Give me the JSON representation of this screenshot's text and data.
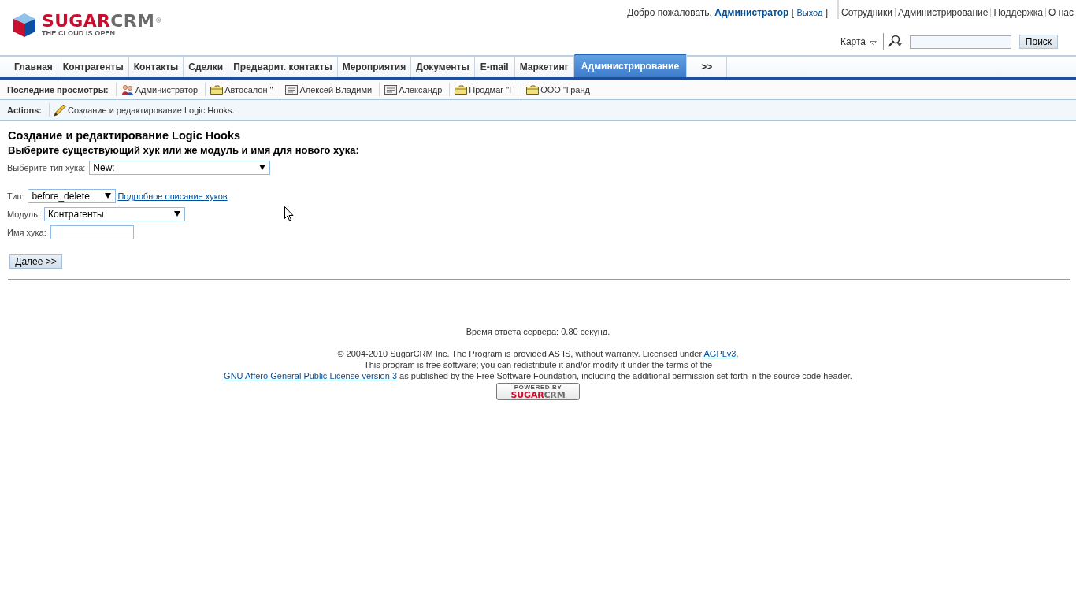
{
  "header": {
    "logo": {
      "brand_primary": "SUGAR",
      "brand_secondary": "CRM",
      "registered_mark": "®",
      "tagline": "THE CLOUD IS OPEN"
    },
    "welcome": {
      "greeting": "Добро пожаловать,",
      "user": "Администратор",
      "logout_open": "[",
      "logout": "Выход",
      "logout_close": "]"
    },
    "top_links": [
      "Сотрудники",
      "Администрирование",
      "Поддержка",
      "О нас"
    ],
    "sitemap": "Карта",
    "search": {
      "button": "Поиск"
    }
  },
  "tabs": [
    {
      "label": "Главная",
      "selected": false
    },
    {
      "label": "Контрагенты",
      "selected": false
    },
    {
      "label": "Контакты",
      "selected": false
    },
    {
      "label": "Сделки",
      "selected": false
    },
    {
      "label": "Предварит. контакты",
      "selected": false
    },
    {
      "label": "Мероприятия",
      "selected": false
    },
    {
      "label": "Документы",
      "selected": false
    },
    {
      "label": "E-mail",
      "selected": false
    },
    {
      "label": "Маркетинг",
      "selected": false
    },
    {
      "label": "Администрирование",
      "selected": true
    },
    {
      "label": ">>",
      "selected": false
    }
  ],
  "recent": {
    "label": "Последние просмотры:",
    "items": [
      {
        "kind": "user",
        "label": "Администратор"
      },
      {
        "kind": "account",
        "label": "Автосалон \""
      },
      {
        "kind": "contact",
        "label": "Алексей Владими"
      },
      {
        "kind": "contact",
        "label": "Александр"
      },
      {
        "kind": "account",
        "label": "Продмаг \"Г"
      },
      {
        "kind": "account",
        "label": "ООО \"Гранд"
      }
    ]
  },
  "actions": {
    "label": "Actions:",
    "items": [
      "Создание и редактирование Logic Hooks."
    ]
  },
  "form": {
    "title": "Создание и редактирование Logic Hooks",
    "subtitle": "Выберите существующий хук или же модуль и имя для нового хука:",
    "hook_choice": {
      "label": "Выберите тип хука:",
      "value": "New:"
    },
    "fields": [
      {
        "kind": "select",
        "label": "Тип:",
        "value": "before_delete",
        "link": "Подробное описание хуков"
      },
      {
        "kind": "select",
        "label": "Модуль:",
        "value": "Контрагенты"
      },
      {
        "kind": "input",
        "label": "Имя хука:"
      }
    ],
    "submit": "Далее >>"
  },
  "footer": {
    "response_time": "Время ответа сервера: 0.80 секунд.",
    "license": {
      "text": "© 2004-2010 SugarCRM Inc. The Program is provided AS IS, without warranty. Licensed under",
      "link": "AGPLv3",
      "end": "."
    },
    "free_software": "This program is free software; you can redistribute it and/or modify it under the terms of the",
    "gnu": {
      "link": "GNU Affero General Public License version 3",
      "text": "as published by the Free Software Foundation, including the additional permission set forth in the source code header."
    },
    "badge": {
      "caption": "POWERED BY",
      "brand_primary": "SUGAR",
      "brand_secondary": "CRM"
    }
  }
}
